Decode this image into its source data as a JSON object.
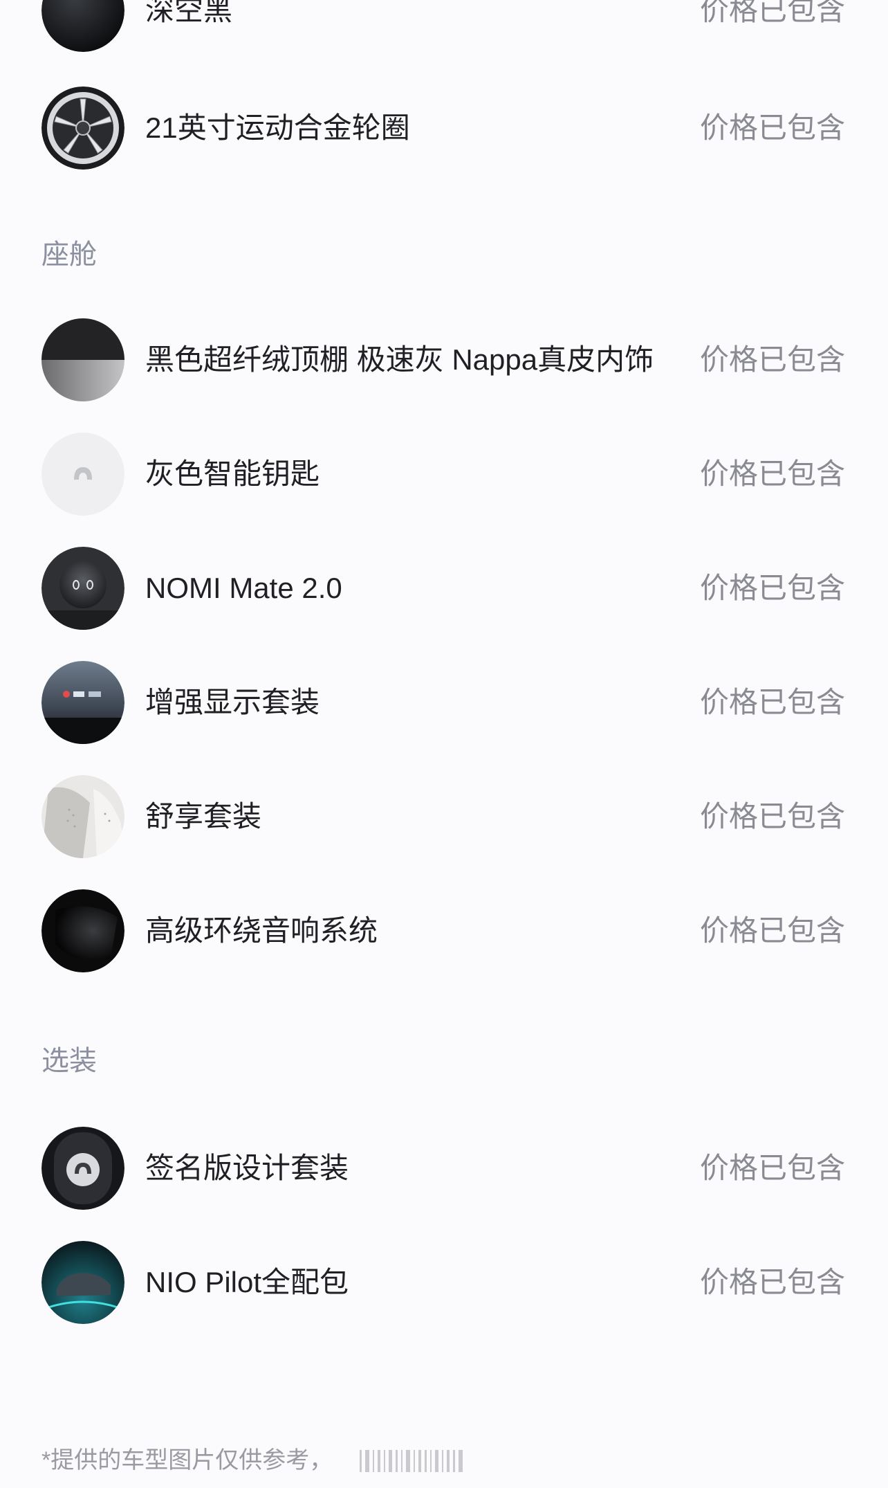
{
  "exterior_items": [
    {
      "label": "深空黑",
      "price": "价格已包含",
      "icon": "deep-space-black-swatch"
    },
    {
      "label": "21英寸运动合金轮圈",
      "price": "价格已包含",
      "icon": "alloy-wheel-image"
    }
  ],
  "cabin": {
    "title": "座舱",
    "items": [
      {
        "label": "黑色超纤绒顶棚 极速灰 Nappa真皮内饰",
        "price": "价格已包含",
        "icon": "interior-swatch"
      },
      {
        "label": "灰色智能钥匙",
        "price": "价格已包含",
        "icon": "smart-key-image"
      },
      {
        "label": "NOMI Mate 2.0",
        "price": "价格已包含",
        "icon": "nomi-mate-image"
      },
      {
        "label": "增强显示套装",
        "price": "价格已包含",
        "icon": "hud-display-image"
      },
      {
        "label": "舒享套装",
        "price": "价格已包含",
        "icon": "comfort-seat-image"
      },
      {
        "label": "高级环绕音响系统",
        "price": "价格已包含",
        "icon": "speaker-image"
      }
    ]
  },
  "options": {
    "title": "选装",
    "items": [
      {
        "label": "签名版设计套装",
        "price": "价格已包含",
        "icon": "signature-badge-image"
      },
      {
        "label": "NIO Pilot全配包",
        "price": "价格已包含",
        "icon": "nio-pilot-car-image"
      }
    ]
  },
  "footer": {
    "disclaimer": "*提供的车型图片仅供参考，"
  },
  "colors": {
    "text": "#1f1f24",
    "price_text": "#8a8a93",
    "section_text": "#8c8fa0",
    "background": "#fbfbfd"
  }
}
